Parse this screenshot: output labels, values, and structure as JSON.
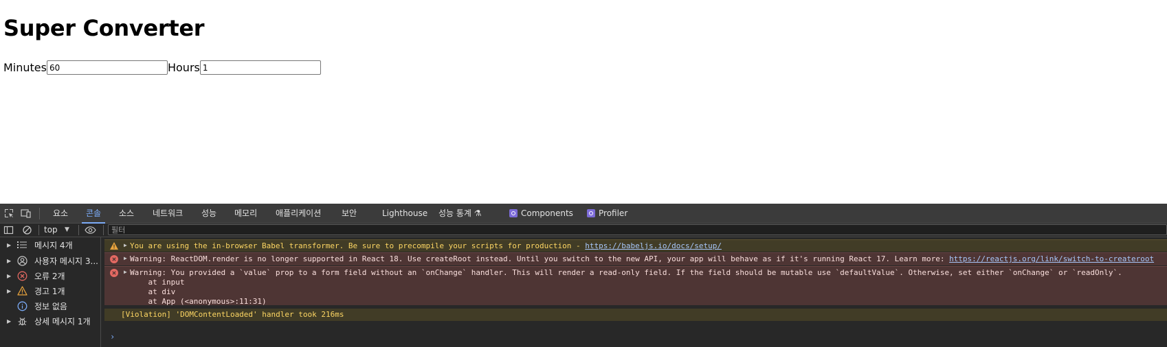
{
  "page": {
    "title": "Super Converter",
    "minutes_label": "Minutes",
    "minutes_value": "60",
    "hours_label": "Hours",
    "hours_value": "1"
  },
  "devtools": {
    "tabs": [
      "요소",
      "콘솔",
      "소스",
      "네트워크",
      "성능",
      "메모리",
      "애플리케이션",
      "보안",
      "Lighthouse",
      "성능 통계 ⚗"
    ],
    "active_tab": "콘솔",
    "extension_tabs": [
      "Components",
      "Profiler"
    ],
    "context": "top",
    "filter_placeholder": "필터",
    "sidebar": [
      {
        "label": "메시지 4개",
        "icon": "list-icon"
      },
      {
        "label": "사용자 메시지 3...",
        "icon": "user-icon"
      },
      {
        "label": "오류 2개",
        "icon": "error-icon"
      },
      {
        "label": "경고 1개",
        "icon": "warning-icon"
      },
      {
        "label": "정보 없음",
        "icon": "info-icon"
      },
      {
        "label": "상세 메시지 1개",
        "icon": "bug-icon"
      }
    ],
    "messages": [
      {
        "type": "warning",
        "text": "You are using the in-browser Babel transformer. Be sure to precompile your scripts for production - ",
        "link": "https://babeljs.io/docs/setup/"
      },
      {
        "type": "error",
        "text": "Warning: ReactDOM.render is no longer supported in React 18. Use createRoot instead. Until you switch to the new API, your app will behave as if it's running React 17. Learn more: ",
        "link": "https://reactjs.org/link/switch-to-createroot"
      },
      {
        "type": "error",
        "text": "Warning: You provided a `value` prop to a form field without an `onChange` handler. This will render a read-only field. If the field should be mutable use `defaultValue`. Otherwise, set either `onChange` or `readOnly`.",
        "stack": [
          "    at input",
          "    at div",
          "    at App (<anonymous>:11:31)"
        ]
      },
      {
        "type": "violation",
        "text": "[Violation] 'DOMContentLoaded' handler took 216ms"
      }
    ],
    "prompt_symbol": "›"
  },
  "colors": {
    "devtools_bg": "#282828",
    "tabbar_bg": "#3b3b3b",
    "accent": "#7cacf8",
    "warning_bg": "#413c26",
    "error_bg": "#4e3534"
  }
}
